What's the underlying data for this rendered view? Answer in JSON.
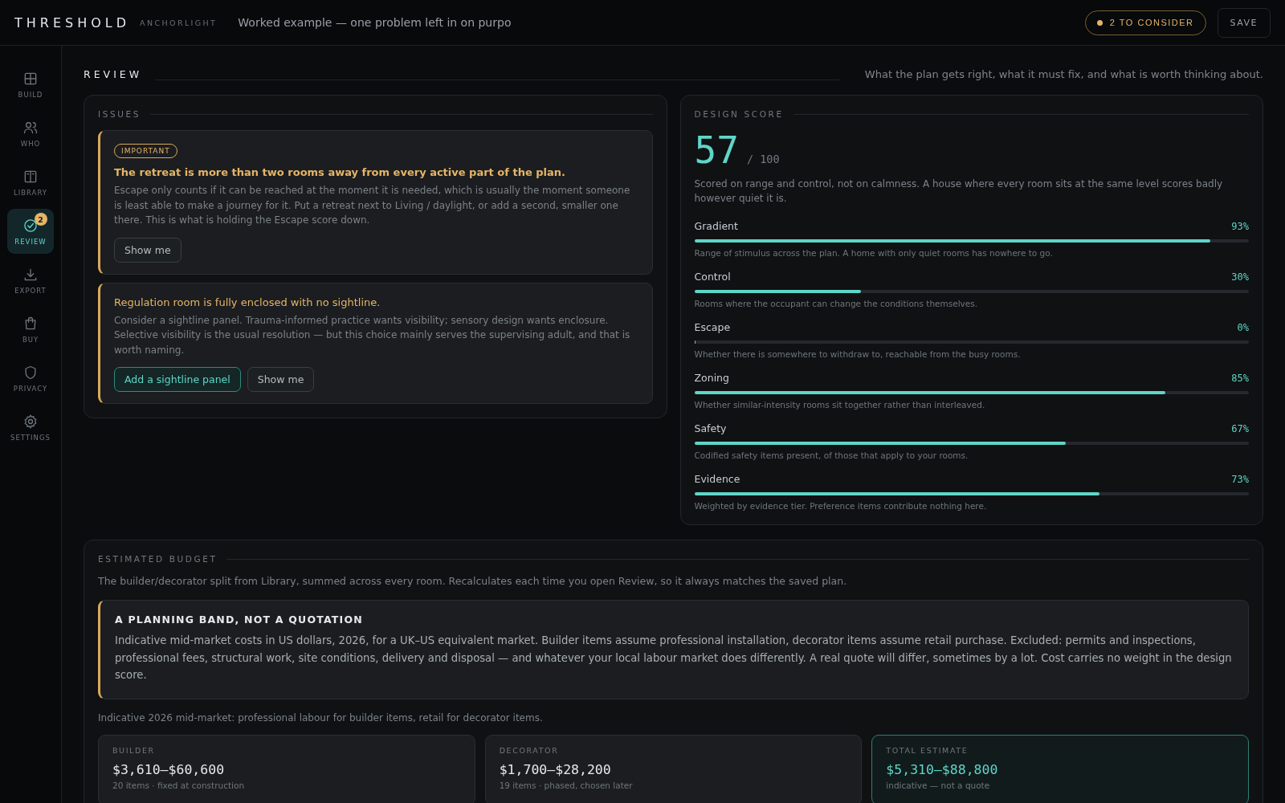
{
  "topbar": {
    "brand": "THRESHOLD",
    "sub_brand": "ANCHORLIGHT",
    "tagline": "Worked example — one problem left in on purpo",
    "consider": "2 TO CONSIDER",
    "save": "SAVE"
  },
  "sidebar": {
    "items": [
      {
        "label": "BUILD",
        "selected": false
      },
      {
        "label": "WHO",
        "selected": false
      },
      {
        "label": "LIBRARY",
        "selected": false
      },
      {
        "label": "REVIEW",
        "selected": true,
        "badge": "2"
      },
      {
        "label": "EXPORT",
        "selected": false
      },
      {
        "label": "BUY",
        "selected": false
      },
      {
        "label": "PRIVACY",
        "selected": false
      },
      {
        "label": "SETTINGS",
        "selected": false
      }
    ]
  },
  "page": {
    "title": "REVIEW",
    "subtitle": "What the plan gets right, what it must fix, and what is worth thinking about."
  },
  "issues": {
    "title": "ISSUES",
    "items": [
      {
        "kind": "important",
        "badge": "IMPORTANT",
        "title": "The retreat is more than two rooms away from every active part of the plan.",
        "body": "Escape only counts if it can be reached at the moment it is needed, which is usually the moment someone is least able to make a journey for it. Put a retreat next to Living / daylight, or add a second, smaller one there. This is what is holding the Escape score down.",
        "actions": [
          {
            "kind": "secondary",
            "label": "Show me"
          }
        ]
      },
      {
        "kind": "consider",
        "title": "Regulation room is fully enclosed with no sightline.",
        "body": "Consider a sightline panel. Trauma-informed practice wants visibility; sensory design wants enclosure. Selective visibility is the usual resolution — but this choice mainly serves the supervising adult, and that is worth naming.",
        "actions": [
          {
            "kind": "primary",
            "label": "Add a sightline panel"
          },
          {
            "kind": "secondary",
            "label": "Show me"
          }
        ]
      }
    ]
  },
  "score": {
    "title": "DESIGN SCORE",
    "value": "57",
    "out_of": "/ 100",
    "note": "Scored on range and control, not on calmness. A house where every room sits at the same level scores badly however quiet it is.",
    "metrics": [
      {
        "name": "Gradient",
        "reading": "93%",
        "level": 0.93,
        "note": "Range of stimulus across the plan. A home with only quiet rooms has nowhere to go."
      },
      {
        "name": "Control",
        "reading": "30%",
        "level": 0.3,
        "note": "Rooms where the occupant can change the conditions themselves."
      },
      {
        "name": "Escape",
        "reading": "0%",
        "level": 0,
        "note": "Whether there is somewhere to withdraw to, reachable from the busy rooms."
      },
      {
        "name": "Zoning",
        "reading": "85%",
        "level": 0.85,
        "note": "Whether similar-intensity rooms sit together rather than interleaved."
      },
      {
        "name": "Safety",
        "reading": "67%",
        "level": 0.67,
        "note": "Codified safety items present, of those that apply to your rooms."
      },
      {
        "name": "Evidence",
        "reading": "73%",
        "level": 0.73,
        "note": "Weighted by evidence tier. Preference items contribute nothing here."
      }
    ]
  },
  "budget": {
    "title": "ESTIMATED BUDGET",
    "intro": "The builder/decorator split from Library, summed across every room. Recalculates each time you open Review, so it always matches the saved plan.",
    "callout": {
      "title": "A PLANNING BAND, NOT A QUOTATION",
      "body": "Indicative mid-market costs in US dollars, 2026, for a UK–US equivalent market. Builder items assume professional installation, decorator items assume retail purchase. Excluded: permits and inspections, professional fees, structural work, site conditions, delivery and disposal — and whatever your local labour market does differently. A real quote will differ, sometimes by a lot. Cost carries no weight in the design score."
    },
    "note": "Indicative 2026 mid-market: professional labour for builder items, retail for decorator items.",
    "tiles": [
      {
        "kind": "part",
        "label": "BUILDER",
        "amount": "$3,610–$60,600",
        "detail": "20 items · fixed at construction"
      },
      {
        "kind": "part",
        "label": "DECORATOR",
        "amount": "$1,700–$28,200",
        "detail": "19 items · phased, chosen later"
      },
      {
        "kind": "total",
        "label": "TOTAL ESTIMATE",
        "amount": "$5,310–$88,800",
        "detail": "indicative — not a quote"
      }
    ]
  }
}
